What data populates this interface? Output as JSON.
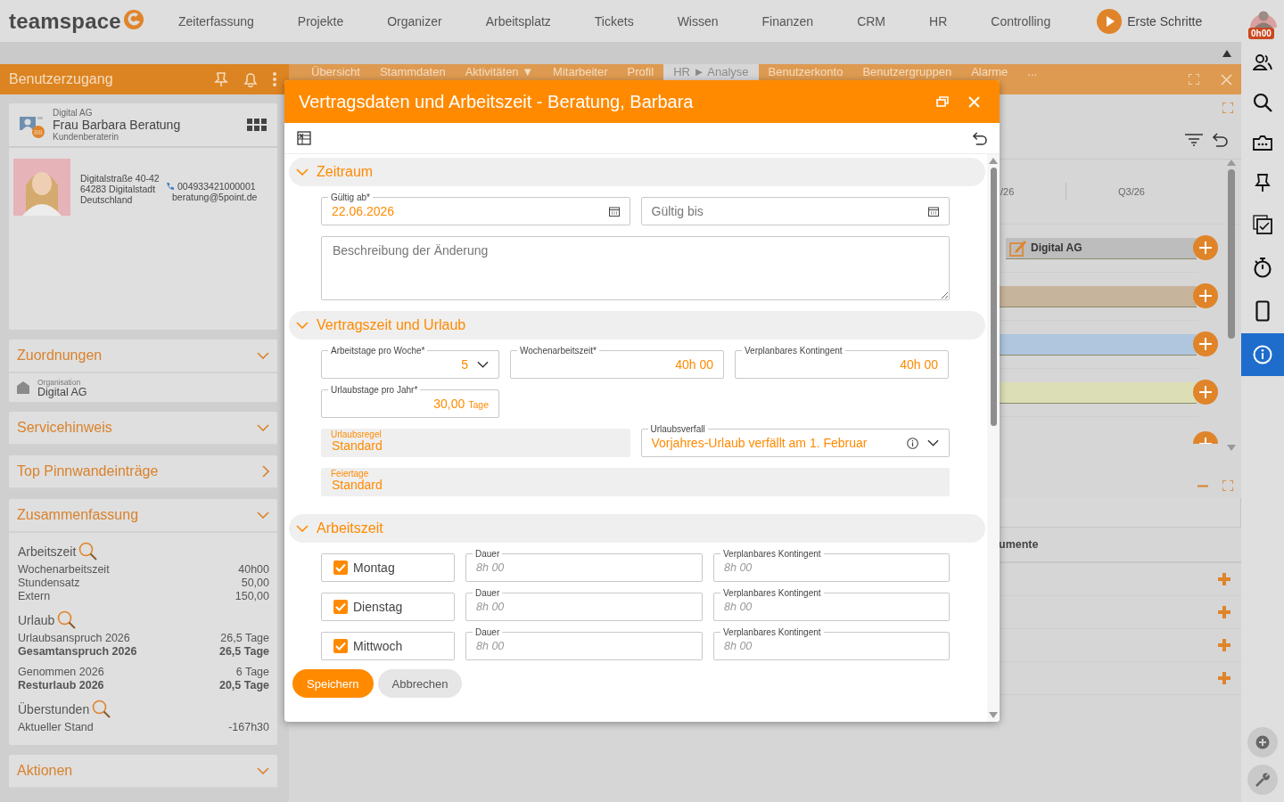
{
  "top_nav": {
    "logo": "teamspace",
    "items": [
      "Zeiterfassung",
      "Projekte",
      "Organizer",
      "Arbeitsplatz",
      "Tickets",
      "Wissen",
      "Finanzen",
      "CRM",
      "HR",
      "Controlling"
    ],
    "start_button": "Erste Schritte",
    "timer": "0h00"
  },
  "left_panel": {
    "title": "Benutzerzugang",
    "contact": {
      "company": "Digital AG",
      "name": "Frau Barbara Beratung",
      "role": "Kundenberaterin",
      "badge": "BB",
      "address": [
        "Digitalstraße 40-42",
        "64283 Digitalstadt",
        "Deutschland"
      ],
      "phone": "004933421000001",
      "email": "beratung@5point.de"
    },
    "sections": [
      {
        "title": "Zuordnungen",
        "kind": "accordion",
        "items": [
          {
            "label": "Organisation",
            "value": "Digital AG"
          }
        ]
      },
      {
        "title": "Servicehinweis",
        "kind": "accordion"
      },
      {
        "title": "Top Pinnwandeinträge",
        "kind": "link"
      },
      {
        "title": "Zusammenfassung",
        "kind": "accordion",
        "groups": [
          {
            "title": "Arbeitszeit",
            "blocks": [
              [
                {
                  "label": "Wochenarbeitszeit",
                  "value": "40h00",
                  "bold": false
                },
                {
                  "label": "Stundensatz",
                  "value": "50,00",
                  "bold": false
                },
                {
                  "label": "Extern",
                  "value": "150,00",
                  "bold": false
                }
              ]
            ]
          },
          {
            "title": "Urlaub",
            "blocks": [
              [
                {
                  "label": "Urlaubsanspruch 2026",
                  "value": "26,5 Tage",
                  "bold": false
                },
                {
                  "label": "Gesamtanspruch 2026",
                  "value": "26,5 Tage",
                  "bold": true
                }
              ],
              [
                {
                  "label": "Genommen 2026",
                  "value": "6 Tage",
                  "bold": false
                },
                {
                  "label": "Resturlaub 2026",
                  "value": "20,5 Tage",
                  "bold": true
                }
              ]
            ]
          },
          {
            "title": "Überstunden",
            "blocks": [
              [
                {
                  "label": "Aktueller Stand",
                  "value": "-167h30",
                  "bold": false
                }
              ]
            ]
          }
        ]
      },
      {
        "title": "Aktionen",
        "kind": "accordion"
      }
    ]
  },
  "main_tabs": [
    {
      "label": "Übersicht",
      "selected": false
    },
    {
      "label": "Stammdaten",
      "selected": false
    },
    {
      "label": "Aktivitäten ▼",
      "selected": false
    },
    {
      "label": "Mitarbeiter",
      "selected": false
    },
    {
      "label": "Profil",
      "selected": false
    },
    {
      "label": "HR ► Analyse",
      "selected": true
    },
    {
      "label": "Benutzerkonto",
      "selected": false
    },
    {
      "label": "Benutzergruppen",
      "selected": false
    },
    {
      "label": "Alarme",
      "selected": false
    }
  ],
  "more_tabs": "...",
  "timeline": {
    "columns": [
      "/26",
      "Q3/26"
    ],
    "rows": [
      {
        "label": "Digital AG",
        "color": "#bdbdbd"
      },
      {
        "color": "#c7b49c"
      },
      {
        "color": "#afc6de"
      },
      {
        "color": "#dcdeb5"
      }
    ]
  },
  "lower_panel": {
    "column": "umente"
  },
  "dialog": {
    "title": "Vertragsdaten und Arbeitszeit - Beratung, Barbara",
    "zeitraum": {
      "title": "Zeitraum",
      "expanded": true,
      "valid_from": {
        "label": "Gültig ab*",
        "value": "22.06.2026"
      },
      "valid_to": {
        "placeholder": "Gültig bis"
      },
      "description": {
        "placeholder": "Beschreibung der Änderung"
      }
    },
    "vertragszeit": {
      "title": "Vertragszeit und Urlaub",
      "expanded": true,
      "workdays": {
        "label": "Arbeitstage pro Woche*",
        "value": "5"
      },
      "weekly": {
        "label": "Wochenarbeitszeit*",
        "value": "40h 00"
      },
      "quota": {
        "label": "Verplanbares Kontingent",
        "value": "40h 00"
      },
      "vacation_days": {
        "label": "Urlaubstage pro Jahr*",
        "value": "30,00",
        "unit": "Tage"
      },
      "vacation_rule": {
        "label": "Urlaubsregel",
        "value": "Standard",
        "readonly": true
      },
      "expiry": {
        "label": "Urlaubsverfall",
        "value": "Vorjahres-Urlaub verfällt am 1. Februar",
        "readonly": false
      },
      "holidays": {
        "label": "Feiertage",
        "value": "Standard",
        "readonly": true
      }
    },
    "arbeitszeit": {
      "title": "Arbeitszeit",
      "expanded": true,
      "days": [
        {
          "label": "Montag",
          "checked": true,
          "duration_label": "Dauer",
          "duration_placeholder": "8h 00",
          "quota_label": "Verplanbares Kontingent",
          "quota_placeholder": "8h 00"
        },
        {
          "label": "Dienstag",
          "checked": true,
          "duration_label": "Dauer",
          "duration_placeholder": "8h 00",
          "quota_label": "Verplanbares Kontingent",
          "quota_placeholder": "8h 00"
        },
        {
          "label": "Mittwoch",
          "checked": true,
          "duration_label": "Dauer",
          "duration_placeholder": "8h 00",
          "quota_label": "Verplanbares Kontingent",
          "quota_placeholder": "8h 00"
        }
      ]
    },
    "save": "Speichern",
    "cancel": "Abbrechen"
  }
}
